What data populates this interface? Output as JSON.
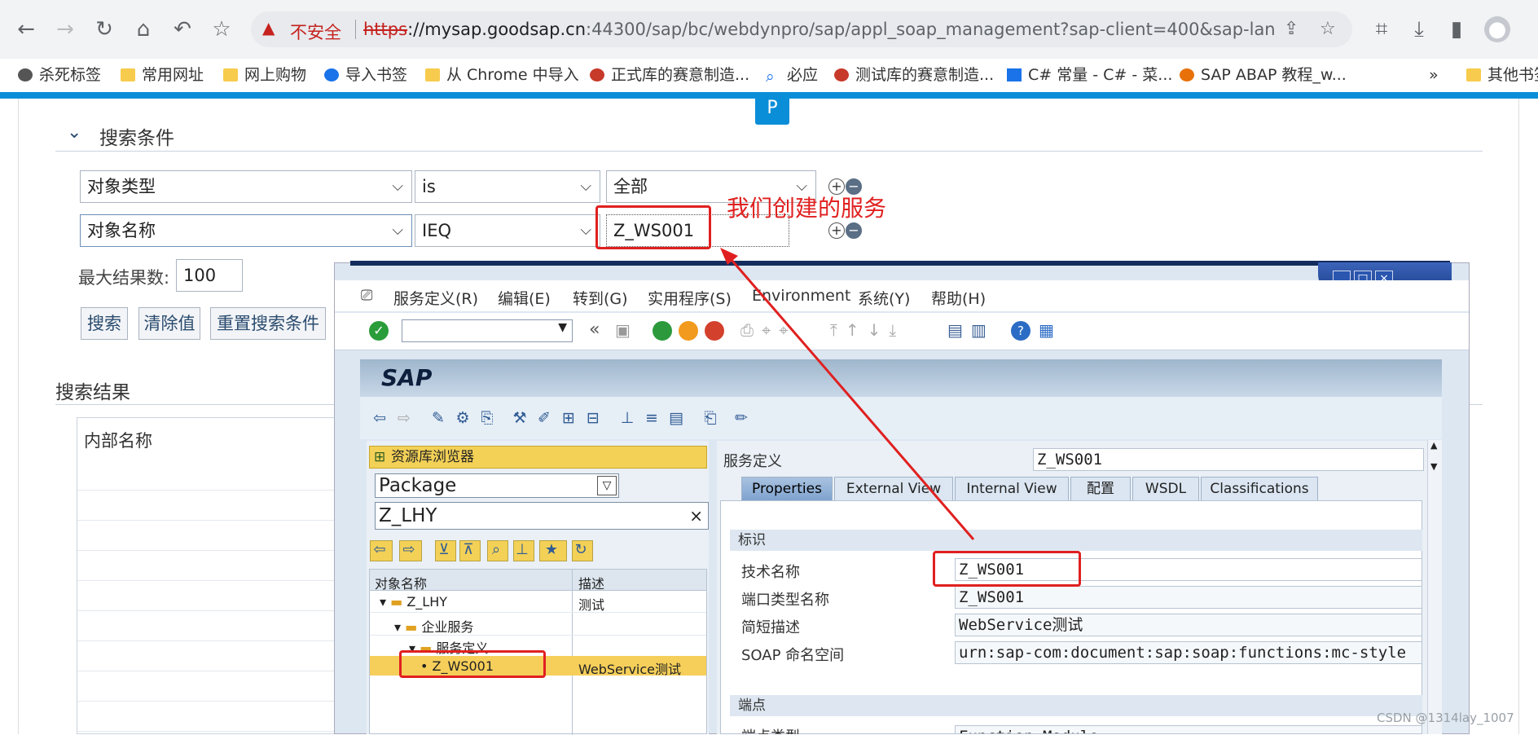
{
  "browser": {
    "insecure_label": "不安全",
    "url_scheme": "https",
    "url_host": "://mysap.goodsap.cn",
    "url_path": ":44300/sap/bc/webdynpro/sap/appl_soap_management?sap-client=400&sap-lang..."
  },
  "bookmarks": [
    {
      "label": "杀死标签"
    },
    {
      "label": "常用网址"
    },
    {
      "label": "网上购物"
    },
    {
      "label": "导入书签"
    },
    {
      "label": "从 Chrome 中导入"
    },
    {
      "label": "正式库的赛意制造..."
    },
    {
      "label": "必应"
    },
    {
      "label": "测试库的赛意制造..."
    },
    {
      "label": "C# 常量 - C# - 菜..."
    },
    {
      "label": "SAP ABAP 教程_w..."
    },
    {
      "label": "»"
    },
    {
      "label": "其他书签"
    }
  ],
  "search": {
    "section_title": "搜索条件",
    "row1": {
      "field": "对象类型",
      "op": "is",
      "value": "全部"
    },
    "row2": {
      "field": "对象名称",
      "op": "IEQ",
      "value": "Z_WS001"
    },
    "max_label": "最大结果数:",
    "max_value": "100",
    "buttons": {
      "search": "搜索",
      "clear": "清除值",
      "reset": "重置搜索条件"
    },
    "results_title": "搜索结果",
    "results_col": "内部名称"
  },
  "annotation": "我们创建的服务",
  "sap": {
    "menu": [
      "服务定义(R)",
      "编辑(E)",
      "转到(G)",
      "实用程序(S)",
      "Environment",
      "系统(Y)",
      "帮助(H)"
    ],
    "logo": "SAP",
    "nav": {
      "header": "资源库浏览器",
      "type": "Package",
      "package": "Z_LHY",
      "col_name": "对象名称",
      "col_desc": "描述",
      "tree": [
        {
          "name": "Z_LHY",
          "desc": "测试"
        },
        {
          "name": "企业服务",
          "desc": ""
        },
        {
          "name": "服务定义",
          "desc": ""
        },
        {
          "name": "Z_WS001",
          "desc": "WebService测试"
        }
      ]
    },
    "detail": {
      "label": "服务定义",
      "value": "Z_WS001",
      "tabs": [
        "Properties",
        "External View",
        "Internal View",
        "配置",
        "WSDL",
        "Classifications"
      ],
      "group1": "标识",
      "fields": [
        {
          "label": "技术名称",
          "value": "Z_WS001"
        },
        {
          "label": "端口类型名称",
          "value": "Z_WS001"
        },
        {
          "label": "简短描述",
          "value": "WebService测试"
        },
        {
          "label": "SOAP 命名空间",
          "value": "urn:sap-com:document:sap:soap:functions:mc-style"
        }
      ],
      "group2": "端点",
      "field_next": {
        "label": "端点类型",
        "value": "Function Module"
      }
    }
  },
  "watermark": "CSDN @1314lay_1007",
  "colors": {
    "accent": "#0a8ed8",
    "annotation": "#e02020",
    "sap_nav": "#f3d157"
  }
}
